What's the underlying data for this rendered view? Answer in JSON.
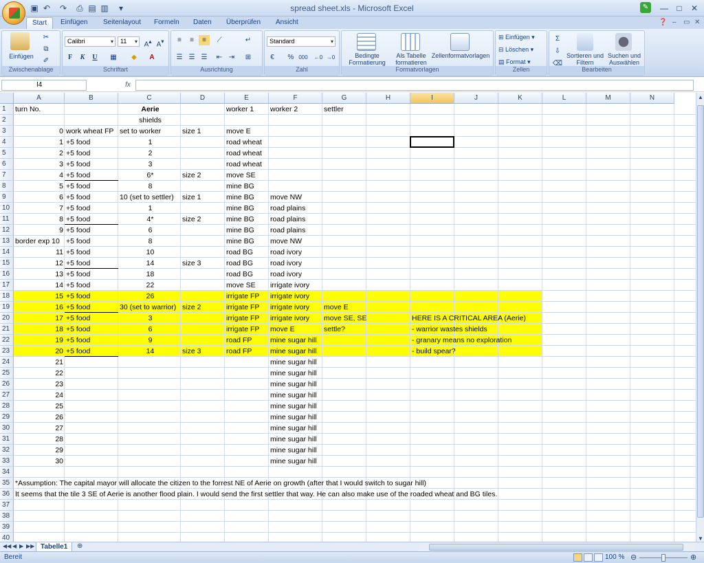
{
  "window": {
    "title": "spread sheet.xls - Microsoft Excel",
    "minimize": "—",
    "maximize": "□",
    "close": "✕"
  },
  "tabs": [
    "Start",
    "Einfügen",
    "Seitenlayout",
    "Formeln",
    "Daten",
    "Überprüfen",
    "Ansicht"
  ],
  "ribbon": {
    "clipboard": {
      "paste": "Einfügen",
      "label": "Zwischenablage"
    },
    "font": {
      "name": "Calibri",
      "size": "11",
      "bold": "F",
      "italic": "K",
      "underline": "U",
      "label": "Schriftart"
    },
    "alignment": {
      "label": "Ausrichtung"
    },
    "number": {
      "format": "Standard",
      "percent": "%",
      "thousands": "000",
      "label": "Zahl"
    },
    "styles": {
      "conditional": "Bedingte Formatierung",
      "table": "Als Tabelle formatieren",
      "cellstyles": "Zellenformatvorlagen",
      "label": "Formatvorlagen"
    },
    "cells": {
      "insert": "Einfügen",
      "delete": "Löschen",
      "format": "Format",
      "label": "Zellen"
    },
    "editing": {
      "sort": "Sortieren und Filtern",
      "find": "Suchen und Auswählen",
      "label": "Bearbeiten"
    }
  },
  "formula_bar": {
    "name_box": "I4",
    "fx": "fx",
    "value": ""
  },
  "columns": [
    "A",
    "B",
    "C",
    "D",
    "E",
    "F",
    "G",
    "H",
    "I",
    "J",
    "K",
    "L",
    "M",
    "N"
  ],
  "selected_column": "I",
  "rows": [
    "1",
    "2",
    "3",
    "4",
    "5",
    "6",
    "7",
    "8",
    "9",
    "10",
    "11",
    "12",
    "13",
    "14",
    "15",
    "16",
    "17",
    "18",
    "19",
    "20",
    "21",
    "22",
    "23",
    "24",
    "25",
    "26",
    "27",
    "28",
    "29",
    "30",
    "31",
    "32",
    "33",
    "34",
    "35",
    "36",
    "37",
    "38",
    "39",
    "40"
  ],
  "cells": [
    {
      "r": 1,
      "c": "A",
      "v": "turn No.",
      "al": "l"
    },
    {
      "r": 1,
      "c": "C",
      "v": "Aerie",
      "al": "c",
      "b": true
    },
    {
      "r": 1,
      "c": "E",
      "v": "worker 1",
      "al": "l"
    },
    {
      "r": 1,
      "c": "F",
      "v": "worker 2",
      "al": "l"
    },
    {
      "r": 1,
      "c": "G",
      "v": "settler",
      "al": "l"
    },
    {
      "r": 2,
      "c": "C",
      "v": "shields",
      "al": "c"
    },
    {
      "r": 3,
      "c": "A",
      "v": "0",
      "al": "r"
    },
    {
      "r": 3,
      "c": "B",
      "v": "work wheat FP",
      "al": "l"
    },
    {
      "r": 3,
      "c": "C",
      "v": "set to worker",
      "al": "l"
    },
    {
      "r": 3,
      "c": "D",
      "v": "size 1",
      "al": "l"
    },
    {
      "r": 3,
      "c": "E",
      "v": "move E",
      "al": "l"
    },
    {
      "r": 4,
      "c": "A",
      "v": "1",
      "al": "r"
    },
    {
      "r": 4,
      "c": "B",
      "v": "+5 food",
      "al": "l"
    },
    {
      "r": 4,
      "c": "C",
      "v": "1",
      "al": "c"
    },
    {
      "r": 4,
      "c": "E",
      "v": "road wheat",
      "al": "l"
    },
    {
      "r": 5,
      "c": "A",
      "v": "2",
      "al": "r"
    },
    {
      "r": 5,
      "c": "B",
      "v": "+5 food",
      "al": "l"
    },
    {
      "r": 5,
      "c": "C",
      "v": "2",
      "al": "c"
    },
    {
      "r": 5,
      "c": "E",
      "v": "road wheat",
      "al": "l"
    },
    {
      "r": 6,
      "c": "A",
      "v": "3",
      "al": "r"
    },
    {
      "r": 6,
      "c": "B",
      "v": "+5 food",
      "al": "l"
    },
    {
      "r": 6,
      "c": "C",
      "v": "3",
      "al": "c"
    },
    {
      "r": 6,
      "c": "E",
      "v": "road wheat",
      "al": "l"
    },
    {
      "r": 7,
      "c": "A",
      "v": "4",
      "al": "r"
    },
    {
      "r": 7,
      "c": "B",
      "v": "+5 food",
      "al": "l",
      "u": true
    },
    {
      "r": 7,
      "c": "C",
      "v": "6*",
      "al": "c"
    },
    {
      "r": 7,
      "c": "D",
      "v": "size 2",
      "al": "l"
    },
    {
      "r": 7,
      "c": "E",
      "v": "move SE",
      "al": "l"
    },
    {
      "r": 8,
      "c": "A",
      "v": "5",
      "al": "r"
    },
    {
      "r": 8,
      "c": "B",
      "v": "+5 food",
      "al": "l"
    },
    {
      "r": 8,
      "c": "C",
      "v": "8",
      "al": "c"
    },
    {
      "r": 8,
      "c": "E",
      "v": "mine BG",
      "al": "l"
    },
    {
      "r": 9,
      "c": "A",
      "v": "6",
      "al": "r"
    },
    {
      "r": 9,
      "c": "B",
      "v": "+5 food",
      "al": "l"
    },
    {
      "r": 9,
      "c": "C",
      "v": "10 (set to settler)",
      "al": "l"
    },
    {
      "r": 9,
      "c": "D",
      "v": "size 1",
      "al": "l"
    },
    {
      "r": 9,
      "c": "E",
      "v": "mine BG",
      "al": "l"
    },
    {
      "r": 9,
      "c": "F",
      "v": "move NW",
      "al": "l"
    },
    {
      "r": 10,
      "c": "A",
      "v": "7",
      "al": "r"
    },
    {
      "r": 10,
      "c": "B",
      "v": "+5 food",
      "al": "l"
    },
    {
      "r": 10,
      "c": "C",
      "v": "1",
      "al": "c"
    },
    {
      "r": 10,
      "c": "E",
      "v": "mine BG",
      "al": "l"
    },
    {
      "r": 10,
      "c": "F",
      "v": "road plains",
      "al": "l"
    },
    {
      "r": 11,
      "c": "A",
      "v": "8",
      "al": "r"
    },
    {
      "r": 11,
      "c": "B",
      "v": "+5 food",
      "al": "l",
      "u": true
    },
    {
      "r": 11,
      "c": "C",
      "v": "4*",
      "al": "c"
    },
    {
      "r": 11,
      "c": "D",
      "v": "size 2",
      "al": "l"
    },
    {
      "r": 11,
      "c": "E",
      "v": "mine BG",
      "al": "l"
    },
    {
      "r": 11,
      "c": "F",
      "v": "road plains",
      "al": "l"
    },
    {
      "r": 12,
      "c": "A",
      "v": "9",
      "al": "r"
    },
    {
      "r": 12,
      "c": "B",
      "v": "+5 food",
      "al": "l"
    },
    {
      "r": 12,
      "c": "C",
      "v": "6",
      "al": "c"
    },
    {
      "r": 12,
      "c": "E",
      "v": "mine BG",
      "al": "l"
    },
    {
      "r": 12,
      "c": "F",
      "v": "road plains",
      "al": "l"
    },
    {
      "r": 13,
      "c": "A",
      "v": "border exp 10",
      "al": "l"
    },
    {
      "r": 13,
      "c": "B",
      "v": "+5 food",
      "al": "l"
    },
    {
      "r": 13,
      "c": "C",
      "v": "8",
      "al": "c"
    },
    {
      "r": 13,
      "c": "E",
      "v": "mine BG",
      "al": "l"
    },
    {
      "r": 13,
      "c": "F",
      "v": "move NW",
      "al": "l"
    },
    {
      "r": 14,
      "c": "A",
      "v": "11",
      "al": "r"
    },
    {
      "r": 14,
      "c": "B",
      "v": "+5 food",
      "al": "l"
    },
    {
      "r": 14,
      "c": "C",
      "v": "10",
      "al": "c"
    },
    {
      "r": 14,
      "c": "E",
      "v": "road BG",
      "al": "l"
    },
    {
      "r": 14,
      "c": "F",
      "v": "road ivory",
      "al": "l"
    },
    {
      "r": 15,
      "c": "A",
      "v": "12",
      "al": "r"
    },
    {
      "r": 15,
      "c": "B",
      "v": "+5 food",
      "al": "l",
      "u": true
    },
    {
      "r": 15,
      "c": "C",
      "v": "14",
      "al": "c"
    },
    {
      "r": 15,
      "c": "D",
      "v": "size 3",
      "al": "l"
    },
    {
      "r": 15,
      "c": "E",
      "v": "road BG",
      "al": "l"
    },
    {
      "r": 15,
      "c": "F",
      "v": "road ivory",
      "al": "l"
    },
    {
      "r": 16,
      "c": "A",
      "v": "13",
      "al": "r"
    },
    {
      "r": 16,
      "c": "B",
      "v": "+5 food",
      "al": "l"
    },
    {
      "r": 16,
      "c": "C",
      "v": "18",
      "al": "c"
    },
    {
      "r": 16,
      "c": "E",
      "v": "road BG",
      "al": "l"
    },
    {
      "r": 16,
      "c": "F",
      "v": "road ivory",
      "al": "l"
    },
    {
      "r": 17,
      "c": "A",
      "v": "14",
      "al": "r"
    },
    {
      "r": 17,
      "c": "B",
      "v": "+5 food",
      "al": "l"
    },
    {
      "r": 17,
      "c": "C",
      "v": "22",
      "al": "c"
    },
    {
      "r": 17,
      "c": "E",
      "v": "move SE",
      "al": "l"
    },
    {
      "r": 17,
      "c": "F",
      "v": "irrigate ivory",
      "al": "l"
    },
    {
      "r": 18,
      "c": "A",
      "v": "15",
      "al": "r"
    },
    {
      "r": 18,
      "c": "B",
      "v": "+5 food",
      "al": "l"
    },
    {
      "r": 18,
      "c": "C",
      "v": "26",
      "al": "c"
    },
    {
      "r": 18,
      "c": "E",
      "v": "irrigate FP",
      "al": "l"
    },
    {
      "r": 18,
      "c": "F",
      "v": "irrigate ivory",
      "al": "l"
    },
    {
      "r": 19,
      "c": "A",
      "v": "16",
      "al": "r"
    },
    {
      "r": 19,
      "c": "B",
      "v": "+5 food",
      "al": "l",
      "u": true
    },
    {
      "r": 19,
      "c": "C",
      "v": "30 (set to warrior)",
      "al": "l"
    },
    {
      "r": 19,
      "c": "D",
      "v": "size 2",
      "al": "l"
    },
    {
      "r": 19,
      "c": "E",
      "v": "irrigate FP",
      "al": "l"
    },
    {
      "r": 19,
      "c": "F",
      "v": "irrigate ivory",
      "al": "l"
    },
    {
      "r": 19,
      "c": "G",
      "v": "move E",
      "al": "l"
    },
    {
      "r": 20,
      "c": "A",
      "v": "17",
      "al": "r"
    },
    {
      "r": 20,
      "c": "B",
      "v": "+5 food",
      "al": "l"
    },
    {
      "r": 20,
      "c": "C",
      "v": "3",
      "al": "c"
    },
    {
      "r": 20,
      "c": "E",
      "v": "irrigate FP",
      "al": "l"
    },
    {
      "r": 20,
      "c": "F",
      "v": "irrigate ivory",
      "al": "l"
    },
    {
      "r": 20,
      "c": "G",
      "v": "move SE, SE",
      "al": "l"
    },
    {
      "r": 20,
      "c": "I",
      "v": "HERE IS A CRITICAL AREA (Aerie)",
      "al": "l"
    },
    {
      "r": 21,
      "c": "A",
      "v": "18",
      "al": "r"
    },
    {
      "r": 21,
      "c": "B",
      "v": "+5 food",
      "al": "l"
    },
    {
      "r": 21,
      "c": "C",
      "v": "6",
      "al": "c"
    },
    {
      "r": 21,
      "c": "E",
      "v": "irrigate FP",
      "al": "l"
    },
    {
      "r": 21,
      "c": "F",
      "v": "move E",
      "al": "l"
    },
    {
      "r": 21,
      "c": "G",
      "v": "settle?",
      "al": "l"
    },
    {
      "r": 21,
      "c": "I",
      "v": "- warrior wastes shields",
      "al": "l"
    },
    {
      "r": 22,
      "c": "A",
      "v": "19",
      "al": "r"
    },
    {
      "r": 22,
      "c": "B",
      "v": "+5 food",
      "al": "l"
    },
    {
      "r": 22,
      "c": "C",
      "v": "9",
      "al": "c"
    },
    {
      "r": 22,
      "c": "E",
      "v": "road FP",
      "al": "l"
    },
    {
      "r": 22,
      "c": "F",
      "v": "mine sugar hill",
      "al": "l"
    },
    {
      "r": 22,
      "c": "I",
      "v": "- granary means no exploration",
      "al": "l"
    },
    {
      "r": 23,
      "c": "A",
      "v": "20",
      "al": "r"
    },
    {
      "r": 23,
      "c": "B",
      "v": "+5 food",
      "al": "l",
      "u": true
    },
    {
      "r": 23,
      "c": "C",
      "v": "14",
      "al": "c"
    },
    {
      "r": 23,
      "c": "D",
      "v": "size 3",
      "al": "l"
    },
    {
      "r": 23,
      "c": "E",
      "v": "road FP",
      "al": "l"
    },
    {
      "r": 23,
      "c": "F",
      "v": "mine sugar hill",
      "al": "l"
    },
    {
      "r": 23,
      "c": "I",
      "v": "- build spear?",
      "al": "l"
    },
    {
      "r": 24,
      "c": "A",
      "v": "21",
      "al": "r"
    },
    {
      "r": 24,
      "c": "F",
      "v": "mine sugar hill",
      "al": "l"
    },
    {
      "r": 25,
      "c": "A",
      "v": "22",
      "al": "r"
    },
    {
      "r": 25,
      "c": "F",
      "v": "mine sugar hill",
      "al": "l"
    },
    {
      "r": 26,
      "c": "A",
      "v": "23",
      "al": "r"
    },
    {
      "r": 26,
      "c": "F",
      "v": "mine sugar hill",
      "al": "l"
    },
    {
      "r": 27,
      "c": "A",
      "v": "24",
      "al": "r"
    },
    {
      "r": 27,
      "c": "F",
      "v": "mine sugar hill",
      "al": "l"
    },
    {
      "r": 28,
      "c": "A",
      "v": "25",
      "al": "r"
    },
    {
      "r": 28,
      "c": "F",
      "v": "mine sugar hill",
      "al": "l"
    },
    {
      "r": 29,
      "c": "A",
      "v": "26",
      "al": "r"
    },
    {
      "r": 29,
      "c": "F",
      "v": "mine sugar hill",
      "al": "l"
    },
    {
      "r": 30,
      "c": "A",
      "v": "27",
      "al": "r"
    },
    {
      "r": 30,
      "c": "F",
      "v": "mine sugar hill",
      "al": "l"
    },
    {
      "r": 31,
      "c": "A",
      "v": "28",
      "al": "r"
    },
    {
      "r": 31,
      "c": "F",
      "v": "mine sugar hill",
      "al": "l"
    },
    {
      "r": 32,
      "c": "A",
      "v": "29",
      "al": "r"
    },
    {
      "r": 32,
      "c": "F",
      "v": "mine sugar hill",
      "al": "l"
    },
    {
      "r": 33,
      "c": "A",
      "v": "30",
      "al": "r"
    },
    {
      "r": 33,
      "c": "F",
      "v": "mine sugar hill",
      "al": "l"
    },
    {
      "r": 35,
      "c": "A",
      "v": "*Assumption: The capital mayor will allocate the citizen to the forrest NE of Aerie on growth (after that I would switch to sugar hill)",
      "al": "l"
    },
    {
      "r": 36,
      "c": "A",
      "v": "It seems that the tile 3 SE of Aerie is another flood plain. I would send the first settler that way. He can also make use of the roaded wheat and BG tiles.",
      "al": "l"
    }
  ],
  "highlight": {
    "color": "#ffff00",
    "rows": [
      18,
      23
    ],
    "cols": [
      "A",
      "K"
    ]
  },
  "selected_cell": "I4",
  "sheet_tabs": [
    "Tabelle1"
  ],
  "status": {
    "ready": "Bereit",
    "zoom": "100 %"
  }
}
